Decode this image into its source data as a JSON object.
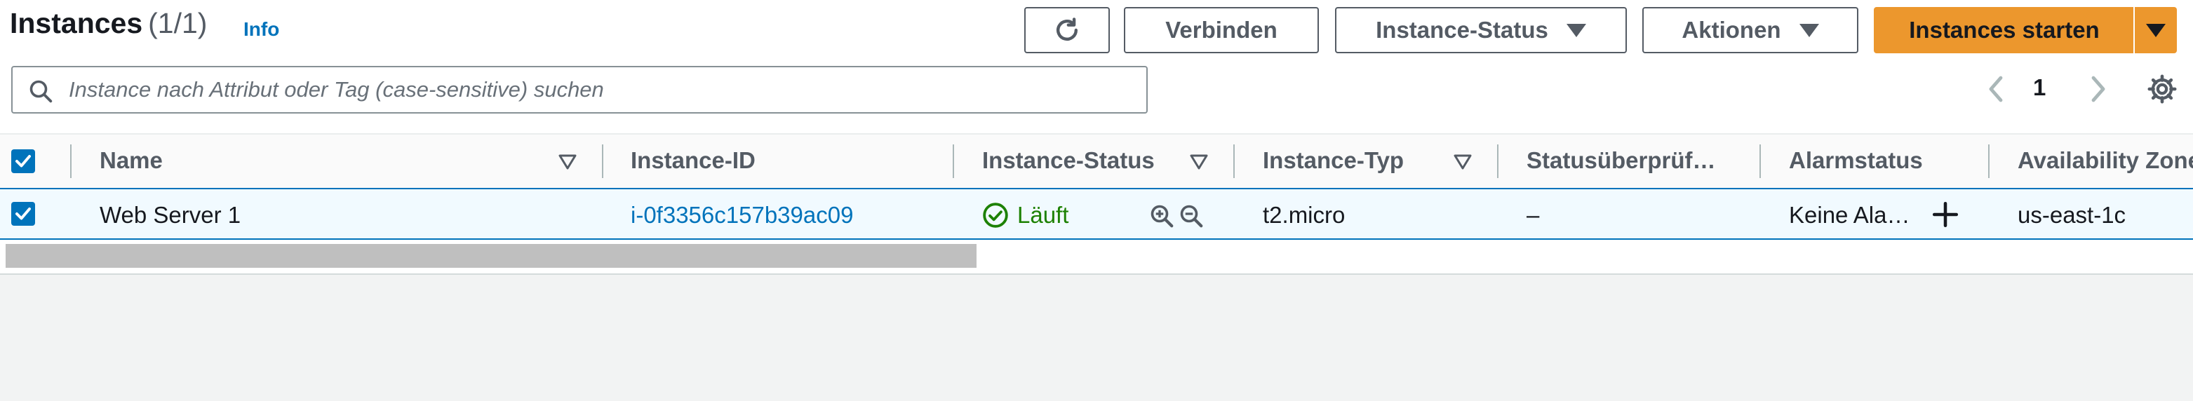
{
  "header": {
    "title": "Instances",
    "count": "(1/1)",
    "info": "Info"
  },
  "toolbar": {
    "refresh_icon": "refresh-icon",
    "connect": "Verbinden",
    "instance_state": "Instance-Status",
    "actions": "Aktionen",
    "launch": "Instances starten",
    "primary_color": "#ec972d"
  },
  "search": {
    "placeholder": "Instance nach Attribut oder Tag (case-sensitive) suchen",
    "value": ""
  },
  "pagination": {
    "page": "1"
  },
  "table": {
    "columns": [
      "Name",
      "Instance-ID",
      "Instance-Status",
      "Instance-Typ",
      "Statusüberprüf…",
      "Alarmstatus",
      "Availability Zone"
    ],
    "rows": [
      {
        "selected": true,
        "name": "Web Server 1",
        "instance_id": "i-0f3356c157b39ac09",
        "state": "Läuft",
        "type": "t2.micro",
        "status_check": "–",
        "alarm": "Keine Ala…",
        "az": "us-east-1c"
      }
    ]
  },
  "colors": {
    "link": "#0073bb",
    "running": "#1d8102",
    "selected_row": "#f1faff"
  }
}
